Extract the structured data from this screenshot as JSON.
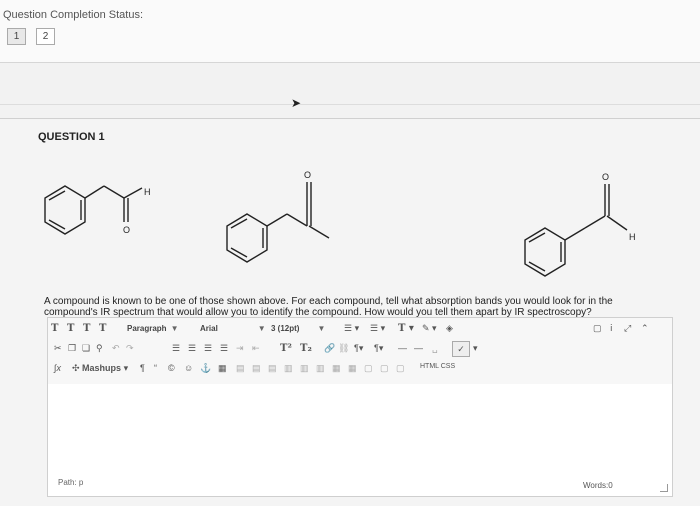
{
  "header": {
    "status_label": "Question Completion Status:",
    "pages": [
      "1",
      "2"
    ]
  },
  "question": {
    "title": "QUESTION 1",
    "text": "A compound is known to be one of those shown above. For each compound, tell what absorption bands you would look for in the compound's IR spectrum that would allow you to identify the compound. How would you tell them apart by IR spectroscopy?",
    "structure_labels": [
      "H",
      "O",
      "O",
      "O",
      "H"
    ]
  },
  "editor": {
    "toolbar_row1": {
      "format_buttons": [
        "T",
        "T",
        "T",
        "T"
      ],
      "paragraph_select": "Paragraph",
      "font_select": "Arial",
      "size_select": "3 (12pt)",
      "list_buttons": [
        "☰",
        "☰"
      ],
      "color_t": "T"
    },
    "toolbar_row2": {
      "superscript": "T²",
      "subscript": "T₂"
    },
    "toolbar_row3": {
      "mashups_label": "Mashups",
      "html_css": "HTML CSS"
    },
    "path_label": "Path: p",
    "words_label": "Words:0"
  }
}
